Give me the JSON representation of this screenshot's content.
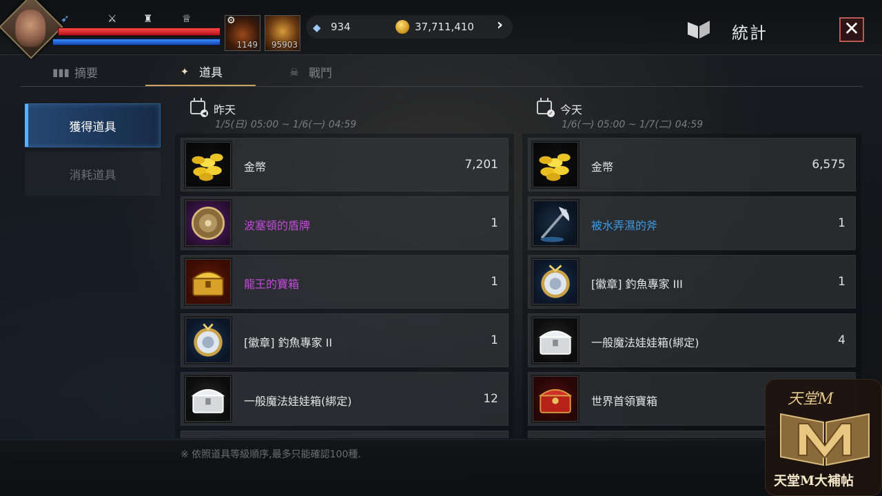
{
  "header": {
    "stat_icons": [
      "wing-icon",
      "crossed-swords-icon",
      "helmet-icon",
      "trophy-icon"
    ],
    "quick_slots": [
      {
        "icon": "potion-icon",
        "count": "1149"
      },
      {
        "icon": "leaf-icon",
        "count": "95903"
      }
    ],
    "currency": {
      "gems": "934",
      "gold": "37,711,410"
    },
    "title": "統計",
    "close_label": "✕"
  },
  "tabs": [
    {
      "label": "摘要",
      "icon": "bar-chart-icon",
      "active": false
    },
    {
      "label": "道具",
      "icon": "item-bag-icon",
      "active": true
    },
    {
      "label": "戰鬥",
      "icon": "skull-swords-icon",
      "active": false
    }
  ],
  "submenu": [
    {
      "label": "獲得道具",
      "active": true
    },
    {
      "label": "消耗道具",
      "active": false
    }
  ],
  "columns": {
    "yesterday": {
      "label": "昨天",
      "range": "1/5(日) 05:00 ~ 1/6(一) 04:59",
      "items": [
        {
          "name": "金幣",
          "qty": "7,201",
          "rarity": "white",
          "icon": "gold-coins-icon"
        },
        {
          "name": "波塞頓的盾牌",
          "qty": "1",
          "rarity": "purple",
          "icon": "shield-icon"
        },
        {
          "name": "龍王的寶箱",
          "qty": "1",
          "rarity": "purple",
          "icon": "gold-chest-icon"
        },
        {
          "name": "[徽章] 釣魚專家 II",
          "qty": "1",
          "rarity": "white",
          "icon": "badge-medal-icon"
        },
        {
          "name": "一般魔法娃娃箱(綁定)",
          "qty": "12",
          "rarity": "white",
          "icon": "silver-chest-icon"
        }
      ]
    },
    "today": {
      "label": "今天",
      "range": "1/6(一) 05:00 ~ 1/7(二) 04:59",
      "items": [
        {
          "name": "金幣",
          "qty": "6,575",
          "rarity": "white",
          "icon": "gold-coins-icon"
        },
        {
          "name": "被水弄濕的斧",
          "qty": "1",
          "rarity": "blue",
          "icon": "axe-icon"
        },
        {
          "name": "[徽章] 釣魚專家 III",
          "qty": "1",
          "rarity": "white",
          "icon": "badge-medal-icon"
        },
        {
          "name": "一般魔法娃娃箱(綁定)",
          "qty": "4",
          "rarity": "white",
          "icon": "silver-chest-icon"
        },
        {
          "name": "世界首領寶箱",
          "qty": "",
          "rarity": "white",
          "icon": "red-chest-icon"
        }
      ]
    }
  },
  "footer_note": "※ 依照道具等級順序,最多只能確認100種.",
  "watermark": {
    "title": "天堂M",
    "caption": "天堂M大補帖"
  }
}
